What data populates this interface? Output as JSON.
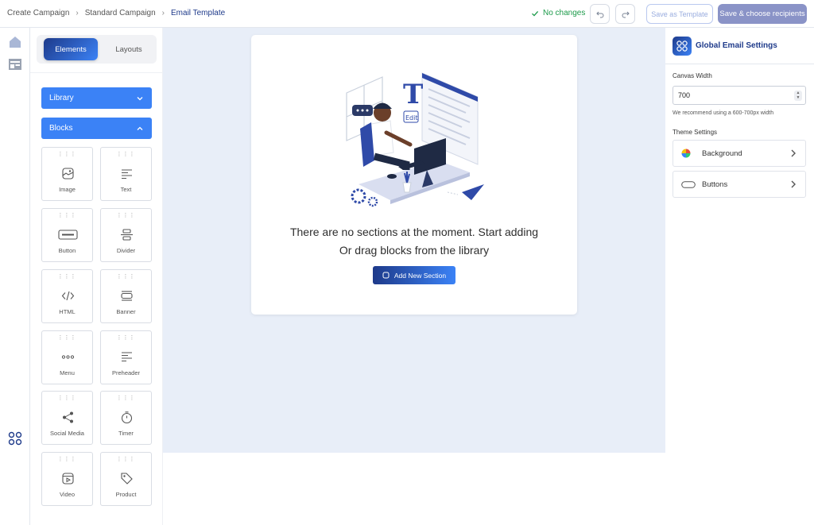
{
  "breadcrumb": {
    "items": [
      "Create Campaign",
      "Standard Campaign",
      "Email Template"
    ]
  },
  "header": {
    "status": "No changes",
    "save_template_label": "Save as Template",
    "save_recipients_label": "Save & choose recipients"
  },
  "elements_panel": {
    "tabs": {
      "elements": "Elements",
      "layouts": "Layouts"
    },
    "library_label": "Library",
    "blocks_label": "Blocks",
    "blocks": [
      "Image",
      "Text",
      "Button",
      "Divider",
      "HTML",
      "Banner",
      "Menu",
      "Preheader",
      "Social Media",
      "Timer",
      "Video",
      "Product"
    ]
  },
  "canvas": {
    "empty_line1": "There are no sections at the moment. Start adding",
    "empty_line2": "Or drag blocks from the library",
    "add_section_label": "Add New Section"
  },
  "settings": {
    "title": "Global Email Settings",
    "canvas_width_label": "Canvas Width",
    "canvas_width_value": "700",
    "canvas_width_hint": "We recommend using a 600-700px width",
    "theme_settings_label": "Theme Settings",
    "options": [
      "Background",
      "Buttons"
    ]
  },
  "colors": {
    "primary": "#1e3a8a",
    "accent": "#3b82f6",
    "success": "#1c9a4a",
    "canvas_bg": "#e8eef8"
  },
  "icons": {
    "home": "home-icon",
    "template": "template-icon",
    "apps": "apps-icon",
    "undo": "undo-icon",
    "redo": "redo-icon",
    "check": "check-icon",
    "chevron": "chevron-right-icon"
  }
}
